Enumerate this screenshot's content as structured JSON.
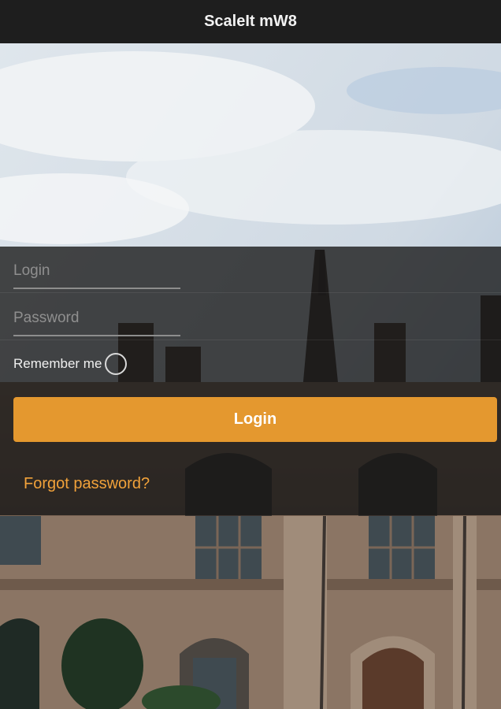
{
  "header": {
    "title": "ScaleIt mW8"
  },
  "form": {
    "login_placeholder": "Login",
    "login_value": "",
    "password_placeholder": "Password",
    "password_value": "",
    "remember_label": "Remember me",
    "login_button": "Login",
    "forgot_link": "Forgot password?"
  },
  "colors": {
    "accent": "#f4a230",
    "link": "#f2a23a",
    "header_bg": "#1e1e1e",
    "panel_overlay": "rgba(22,22,22,0.78)"
  }
}
